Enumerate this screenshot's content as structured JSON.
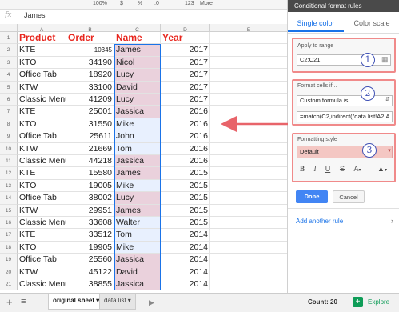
{
  "toolbar": {
    "zoom": "100%",
    "currency": "$",
    "percent": "%",
    "decimals": ".0",
    ".00": ".00",
    "format": "123",
    "more": "More"
  },
  "formula_bar": {
    "fx": "fx",
    "value": "James"
  },
  "columns": [
    "A",
    "B",
    "C",
    "D",
    "E"
  ],
  "headers": {
    "product": "Product",
    "order": "Order",
    "name": "Name",
    "year": "Year"
  },
  "rows": [
    {
      "n": "2",
      "p": "KTE",
      "o": "10345",
      "nm": "James",
      "y": "2017",
      "hl": true
    },
    {
      "n": "3",
      "p": "KTO",
      "o": "34190",
      "nm": "Nicol",
      "y": "2017",
      "hl": true
    },
    {
      "n": "4",
      "p": "Office Tab",
      "o": "18920",
      "nm": "Lucy",
      "y": "2017",
      "hl": true
    },
    {
      "n": "5",
      "p": "KTW",
      "o": "33100",
      "nm": "David",
      "y": "2017",
      "hl": true
    },
    {
      "n": "6",
      "p": "Classic Menu",
      "o": "41209",
      "nm": "Lucy",
      "y": "2017",
      "hl": true
    },
    {
      "n": "7",
      "p": "KTE",
      "o": "25001",
      "nm": "Jassica",
      "y": "2016",
      "hl": true
    },
    {
      "n": "8",
      "p": "KTO",
      "o": "31550",
      "nm": "Mike",
      "y": "2016",
      "hl": false
    },
    {
      "n": "9",
      "p": "Office Tab",
      "o": "25611",
      "nm": "John",
      "y": "2016",
      "hl": false
    },
    {
      "n": "10",
      "p": "KTW",
      "o": "21669",
      "nm": "Tom",
      "y": "2016",
      "hl": false
    },
    {
      "n": "11",
      "p": "Classic Menu",
      "o": "44218",
      "nm": "Jassica",
      "y": "2016",
      "hl": true
    },
    {
      "n": "12",
      "p": "KTE",
      "o": "15580",
      "nm": "James",
      "y": "2015",
      "hl": true
    },
    {
      "n": "13",
      "p": "KTO",
      "o": "19005",
      "nm": "Mike",
      "y": "2015",
      "hl": false
    },
    {
      "n": "14",
      "p": "Office Tab",
      "o": "38002",
      "nm": "Lucy",
      "y": "2015",
      "hl": true
    },
    {
      "n": "15",
      "p": "KTW",
      "o": "29951",
      "nm": "James",
      "y": "2015",
      "hl": true
    },
    {
      "n": "16",
      "p": "Classic Menu",
      "o": "33608",
      "nm": "Walter",
      "y": "2015",
      "hl": false
    },
    {
      "n": "17",
      "p": "KTE",
      "o": "33512",
      "nm": "Tom",
      "y": "2014",
      "hl": false
    },
    {
      "n": "18",
      "p": "KTO",
      "o": "19905",
      "nm": "Mike",
      "y": "2014",
      "hl": false
    },
    {
      "n": "19",
      "p": "Office Tab",
      "o": "25560",
      "nm": "Jassica",
      "y": "2014",
      "hl": true
    },
    {
      "n": "20",
      "p": "KTW",
      "o": "45122",
      "nm": "David",
      "y": "2014",
      "hl": true
    },
    {
      "n": "21",
      "p": "Classic Menu",
      "o": "38855",
      "nm": "Jassica",
      "y": "2014",
      "hl": true
    }
  ],
  "sheetbar": {
    "tabs": [
      "original sheet",
      "data list"
    ],
    "count": "Count: 20",
    "explore": "Explore"
  },
  "panel": {
    "title": "Conditional format rules",
    "tabs": [
      "Single color",
      "Color scale"
    ],
    "apply_label": "Apply to range",
    "range": "C2:C21",
    "format_if_label": "Format cells if...",
    "condition": "Custom formula is",
    "formula": "=match(C2,indirect(\"data list!A2:A",
    "style_label": "Formatting style",
    "style": "Default",
    "done": "Done",
    "cancel": "Cancel",
    "add_rule": "Add another rule",
    "steps": [
      "1",
      "2",
      "3"
    ]
  }
}
